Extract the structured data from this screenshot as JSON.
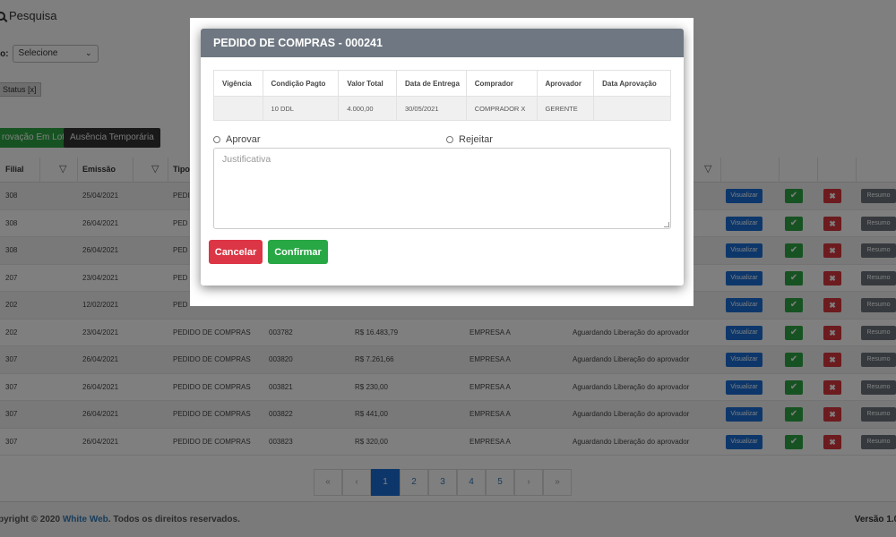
{
  "page": {
    "search_title": "Pesquisa",
    "tipo_label": "po:",
    "tipo_select": "Selecione",
    "status_chip": "Status [x]",
    "btn_lote": "rovação Em Lote",
    "btn_ausencia": "Ausência Temporária",
    "headers": {
      "filial": "Filial",
      "emissao": "Emissão",
      "tipo": "Tipo"
    },
    "rows": [
      {
        "filial": "308",
        "emissao": "25/04/2021",
        "tipo": "PEDID",
        "num": "",
        "valor": "",
        "empresa": "",
        "status": ""
      },
      {
        "filial": "308",
        "emissao": "26/04/2021",
        "tipo": "PED",
        "num": "",
        "valor": "",
        "empresa": "",
        "status": ""
      },
      {
        "filial": "308",
        "emissao": "26/04/2021",
        "tipo": "PED",
        "num": "",
        "valor": "",
        "empresa": "",
        "status": ""
      },
      {
        "filial": "207",
        "emissao": "23/04/2021",
        "tipo": "PED",
        "num": "",
        "valor": "",
        "empresa": "",
        "status": ""
      },
      {
        "filial": "202",
        "emissao": "12/02/2021",
        "tipo": "PED",
        "num": "",
        "valor": "",
        "empresa": "",
        "status": ""
      },
      {
        "filial": "202",
        "emissao": "23/04/2021",
        "tipo": "PEDIDO DE COMPRAS",
        "num": "003782",
        "valor": "R$   16.483,79",
        "empresa": "EMPRESA A",
        "status": "Aguardando Liberação do aprovador"
      },
      {
        "filial": "307",
        "emissao": "26/04/2021",
        "tipo": "PEDIDO DE COMPRAS",
        "num": "003820",
        "valor": "R$   7.261,66",
        "empresa": "EMPRESA A",
        "status": "Aguardando Liberação do aprovador"
      },
      {
        "filial": "307",
        "emissao": "26/04/2021",
        "tipo": "PEDIDO DE COMPRAS",
        "num": "003821",
        "valor": "R$   230,00",
        "empresa": "EMPRESA A",
        "status": "Aguardando Liberação do aprovador"
      },
      {
        "filial": "307",
        "emissao": "26/04/2021",
        "tipo": "PEDIDO DE COMPRAS",
        "num": "003822",
        "valor": "R$   441,00",
        "empresa": "EMPRESA A",
        "status": "Aguardando Liberação do aprovador"
      },
      {
        "filial": "307",
        "emissao": "26/04/2021",
        "tipo": "PEDIDO DE COMPRAS",
        "num": "003823",
        "valor": "R$   320,00",
        "empresa": "EMPRESA A",
        "status": "Aguardando Liberação do aprovador"
      }
    ],
    "row_buttons": {
      "visualizar": "Visualizar",
      "ok": "✔",
      "x": "✖",
      "resumo": "Resumo"
    },
    "pagination": [
      "«",
      "‹",
      "1",
      "2",
      "3",
      "4",
      "5",
      "›",
      "»"
    ],
    "pagination_active": "1",
    "footer": {
      "copy_prefix": "pyright © 2020 ",
      "brand": "White Web",
      "copy_suffix": ". Todos os direitos reservados.",
      "version": "Versão 1.0."
    }
  },
  "modal": {
    "title": "PEDIDO DE COMPRAS - 000241",
    "columns": [
      "Vigência",
      "Condição Pagto",
      "Valor Total",
      "Data de Entrega",
      "Comprador",
      "Aprovador",
      "Data Aprovação"
    ],
    "values": [
      "",
      "10 DDL",
      "4.000,00",
      "30/05/2021",
      "COMPRADOR X",
      "GERENTE",
      ""
    ],
    "approve_label": "Aprovar",
    "reject_label": "Rejeitar",
    "justification_placeholder": "Justificativa",
    "cancel_label": "Cancelar",
    "confirm_label": "Confirmar"
  },
  "colors": {
    "header": "#6f7882",
    "primary": "#1a6fd6",
    "success": "#28a745",
    "danger": "#dc3545",
    "secondary": "#6c757d"
  }
}
